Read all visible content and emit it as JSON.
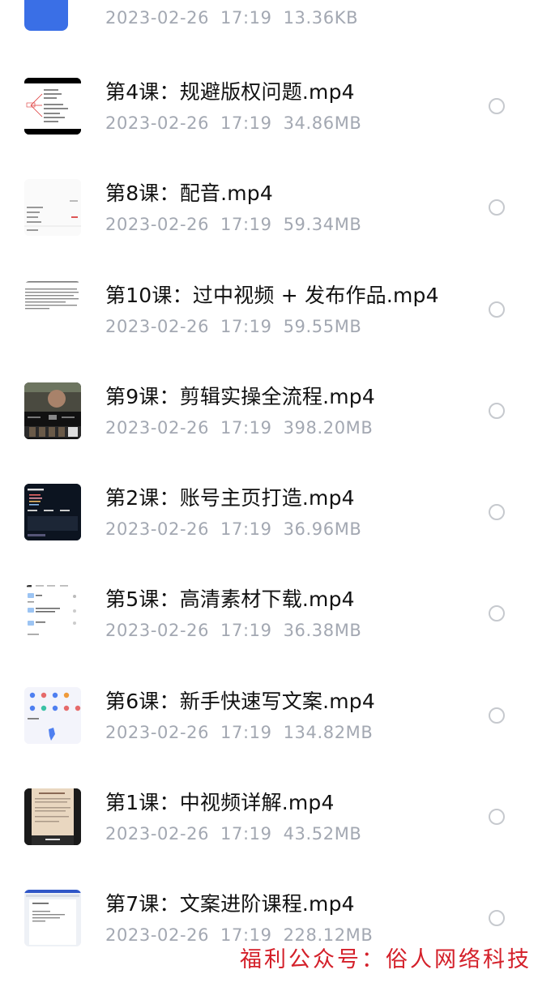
{
  "partial_row": {
    "date": "2023-02-26",
    "time": "17:19",
    "size": "13.36KB"
  },
  "files": [
    {
      "name": "第4课：规避版权问题.mp4",
      "date": "2023-02-26",
      "time": "17:19",
      "size": "34.86MB",
      "thumbnail": "mindmap-thumbnail",
      "selected": false
    },
    {
      "name": "第8课：配音.mp4",
      "date": "2023-02-26",
      "time": "17:19",
      "size": "59.34MB",
      "thumbnail": "settings-screen-thumbnail",
      "selected": false
    },
    {
      "name": "第10课：过中视频 + 发布作品.mp4",
      "date": "2023-02-26",
      "time": "17:19",
      "size": "59.55MB",
      "thumbnail": "text-document-thumbnail",
      "selected": false
    },
    {
      "name": "第9课：剪辑实操全流程.mp4",
      "date": "2023-02-26",
      "time": "17:19",
      "size": "398.20MB",
      "thumbnail": "video-editor-thumbnail",
      "selected": false
    },
    {
      "name": "第2课：账号主页打造.mp4",
      "date": "2023-02-26",
      "time": "17:19",
      "size": "36.96MB",
      "thumbnail": "dark-profile-thumbnail",
      "selected": false
    },
    {
      "name": "第5课：高清素材下载.mp4",
      "date": "2023-02-26",
      "time": "17:19",
      "size": "36.38MB",
      "thumbnail": "cloud-drive-thumbnail",
      "selected": false
    },
    {
      "name": "第6课：新手快速写文案.mp4",
      "date": "2023-02-26",
      "time": "17:19",
      "size": "134.82MB",
      "thumbnail": "app-grid-thumbnail",
      "selected": false
    },
    {
      "name": "第1课：中视频详解.mp4",
      "date": "2023-02-26",
      "time": "17:19",
      "size": "43.52MB",
      "thumbnail": "phone-screen-thumbnail",
      "selected": false
    },
    {
      "name": "第7课：文案进阶课程.mp4",
      "date": "2023-02-26",
      "time": "17:19",
      "size": "228.12MB",
      "thumbnail": "document-editor-thumbnail",
      "selected": false
    }
  ],
  "watermark": "福利公众号：俗人网络科技",
  "colors": {
    "name_text": "#111111",
    "meta_text": "#a3a8b2",
    "radio_border": "#c6c9ce",
    "watermark": "#d4202a",
    "partial_thumb": "#3a6fe6"
  }
}
